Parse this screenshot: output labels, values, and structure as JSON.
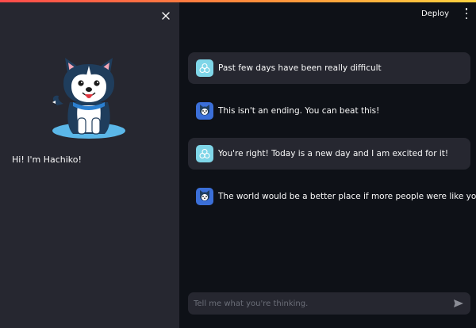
{
  "sidebar": {
    "greeting": "Hi! I'm Hachiko!",
    "mascot_icon": "husky-dog-mascot",
    "close_icon": "close-icon"
  },
  "header": {
    "deploy_label": "Deploy",
    "menu_icon": "kebab-menu-icon"
  },
  "messages": [
    {
      "role": "user",
      "avatar": "user-avatar-icon",
      "text": "Past few days have been really difficult"
    },
    {
      "role": "assistant",
      "avatar": "husky-avatar-icon",
      "text": "This isn't an ending. You can beat this!"
    },
    {
      "role": "user",
      "avatar": "user-avatar-icon",
      "text": "You're right! Today is a new day and I am excited for it!"
    },
    {
      "role": "assistant",
      "avatar": "husky-avatar-icon",
      "text": "The world would be a better place if more people were like you!"
    }
  ],
  "chat_input": {
    "placeholder": "Tell me what you're thinking.",
    "value": "",
    "send_icon": "send-icon"
  },
  "colors": {
    "background": "#0e1117",
    "sidebar": "#262730",
    "user_avatar": "#7fd6e8",
    "bot_avatar": "#3b6fd8",
    "accent_bar": "#ff4b4b"
  }
}
